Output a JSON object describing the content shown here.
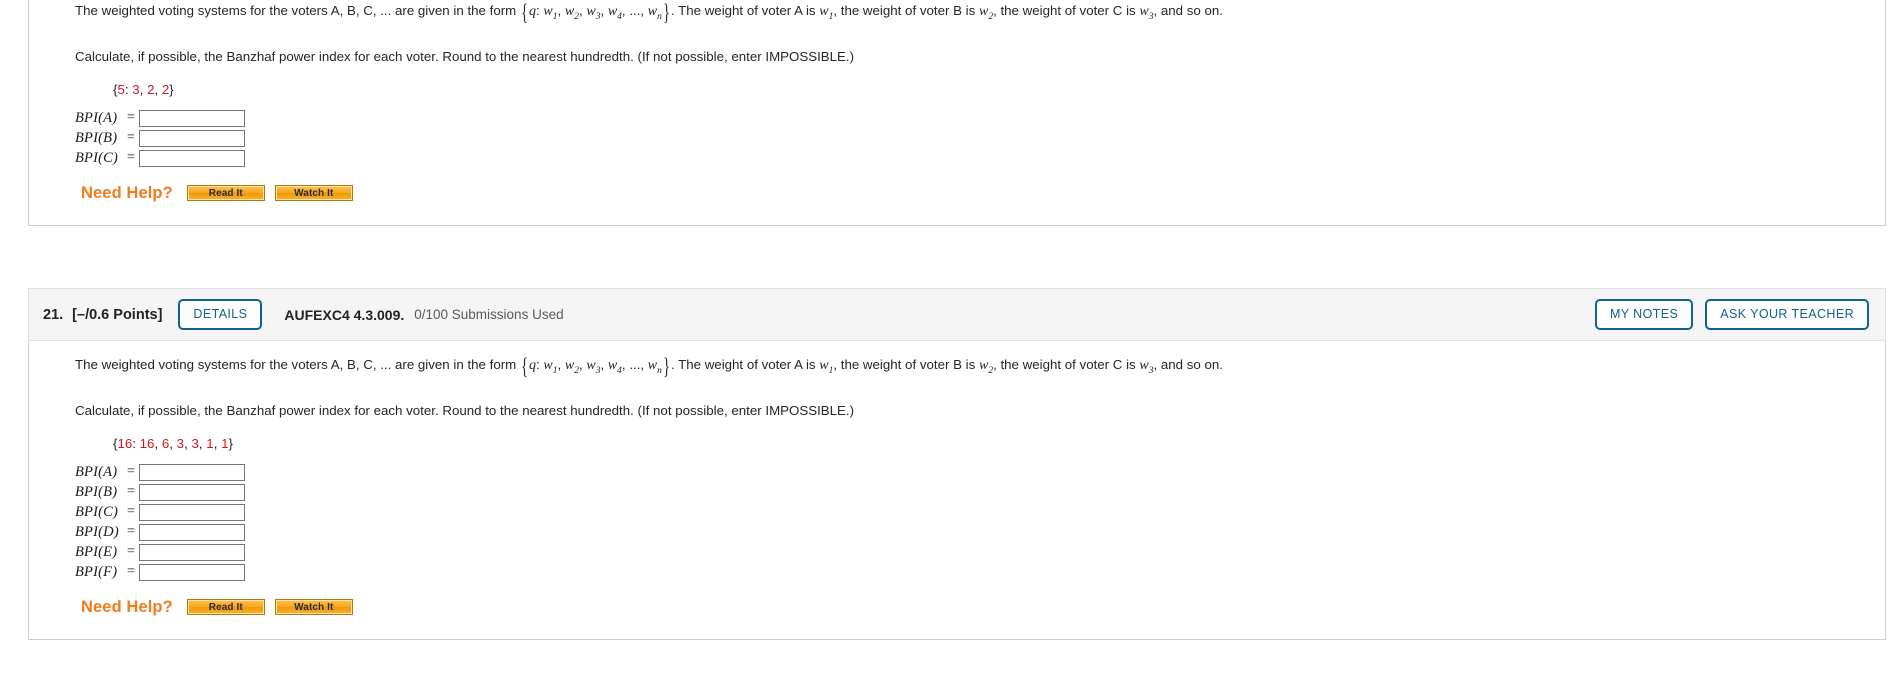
{
  "questions": [
    {
      "id": "q20",
      "show_header": false,
      "header": {
        "number": "",
        "points": "",
        "details_label": "DETAILS",
        "code": "",
        "submissions": "",
        "my_notes_label": "MY NOTES",
        "ask_teacher_label": "ASK YOUR TEACHER"
      },
      "prose_1": {
        "lead": "The weighted voting systems for the voters A, B, C, ... are given in the form",
        "q_var": "q",
        "colon": ":",
        "w_list": [
          "1",
          "2",
          "3",
          "4"
        ],
        "ellipsis": "...,",
        "w_last": "n",
        "tail_1": ". The weight of voter A is",
        "tail_1_sub": "1",
        "tail_2": ", the weight of voter B is",
        "tail_2_sub": "2",
        "tail_3": ", the weight of voter C is",
        "tail_3_sub": "3",
        "tail_4": ", and so on."
      },
      "prose_2": "Calculate, if possible, the Banzhaf power index for each voter. Round to the nearest hundredth. (If not possible, enter IMPOSSIBLE.)",
      "weights": {
        "open": "{",
        "quota": "5",
        "sep": ":",
        "values": [
          "3",
          "2",
          "2"
        ],
        "close": "}"
      },
      "answers": [
        {
          "label": "BPI(A)",
          "eq": "=",
          "value": ""
        },
        {
          "label": "BPI(B)",
          "eq": "=",
          "value": ""
        },
        {
          "label": "BPI(C)",
          "eq": "=",
          "value": ""
        }
      ],
      "need_help": {
        "label": "Need Help?",
        "read_label": "Read It",
        "watch_label": "Watch It"
      }
    },
    {
      "id": "q21",
      "show_header": true,
      "header": {
        "number": "21.",
        "points": "[–/0.6 Points]",
        "details_label": "DETAILS",
        "code": "AUFEXC4 4.3.009.",
        "submissions": "0/100 Submissions Used",
        "my_notes_label": "MY NOTES",
        "ask_teacher_label": "ASK YOUR TEACHER"
      },
      "prose_1": {
        "lead": "The weighted voting systems for the voters A, B, C, ... are given in the form",
        "q_var": "q",
        "colon": ":",
        "w_list": [
          "1",
          "2",
          "3",
          "4"
        ],
        "ellipsis": "...,",
        "w_last": "n",
        "tail_1": ". The weight of voter A is",
        "tail_1_sub": "1",
        "tail_2": ", the weight of voter B is",
        "tail_2_sub": "2",
        "tail_3": ", the weight of voter C is",
        "tail_3_sub": "3",
        "tail_4": ", and so on."
      },
      "prose_2": "Calculate, if possible, the Banzhaf power index for each voter. Round to the nearest hundredth. (If not possible, enter IMPOSSIBLE.)",
      "weights": {
        "open": "{",
        "quota": "16",
        "sep": ":",
        "values": [
          "16",
          "6",
          "3",
          "3",
          "1",
          "1"
        ],
        "close": "}"
      },
      "answers": [
        {
          "label": "BPI(A)",
          "eq": "=",
          "value": ""
        },
        {
          "label": "BPI(B)",
          "eq": "=",
          "value": ""
        },
        {
          "label": "BPI(C)",
          "eq": "=",
          "value": ""
        },
        {
          "label": "BPI(D)",
          "eq": "=",
          "value": ""
        },
        {
          "label": "BPI(E)",
          "eq": "=",
          "value": ""
        },
        {
          "label": "BPI(F)",
          "eq": "=",
          "value": ""
        }
      ],
      "need_help": {
        "label": "Need Help?",
        "read_label": "Read It",
        "watch_label": "Watch It"
      }
    }
  ],
  "colors": {
    "accent_blue": "#10618f",
    "help_orange": "#f07c1e",
    "weight_red": "#d1181f",
    "header_bg": "#f5f5f5",
    "border_gray": "#cfcfcf"
  }
}
